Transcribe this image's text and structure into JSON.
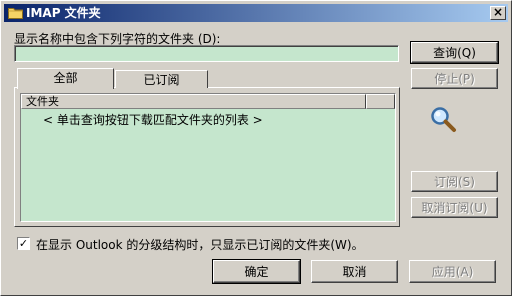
{
  "window": {
    "title": "IMAP 文件夹",
    "close_label": "×"
  },
  "filter": {
    "label": "显示名称中包含下列字符的文件夹 (D):",
    "value": ""
  },
  "tabs": [
    {
      "label": "全部",
      "selected": true
    },
    {
      "label": "已订阅",
      "selected": false
    }
  ],
  "folder_list": {
    "column_header": "文件夹",
    "message": "< 单击查询按钮下载匹配文件夹的列表 >"
  },
  "buttons": {
    "query": "查询(Q)",
    "stop": "停止(P)",
    "subscribe": "订阅(S)",
    "unsubscribe": "取消订阅(U)",
    "ok": "确定",
    "cancel": "取消",
    "apply": "应用(A)"
  },
  "option": {
    "checked": true,
    "check_mark": "✓",
    "label": "在显示 Outlook 的分级结构时，只显示已订阅的文件夹(W)。"
  },
  "colors": {
    "titlebar_start": "#0a246a",
    "titlebar_end": "#a6caf0",
    "field_background": "#c5e6cd",
    "dialog_background": "#d4d0c8"
  },
  "icons": {
    "title": "folder-icon",
    "search": "magnifier-icon"
  }
}
